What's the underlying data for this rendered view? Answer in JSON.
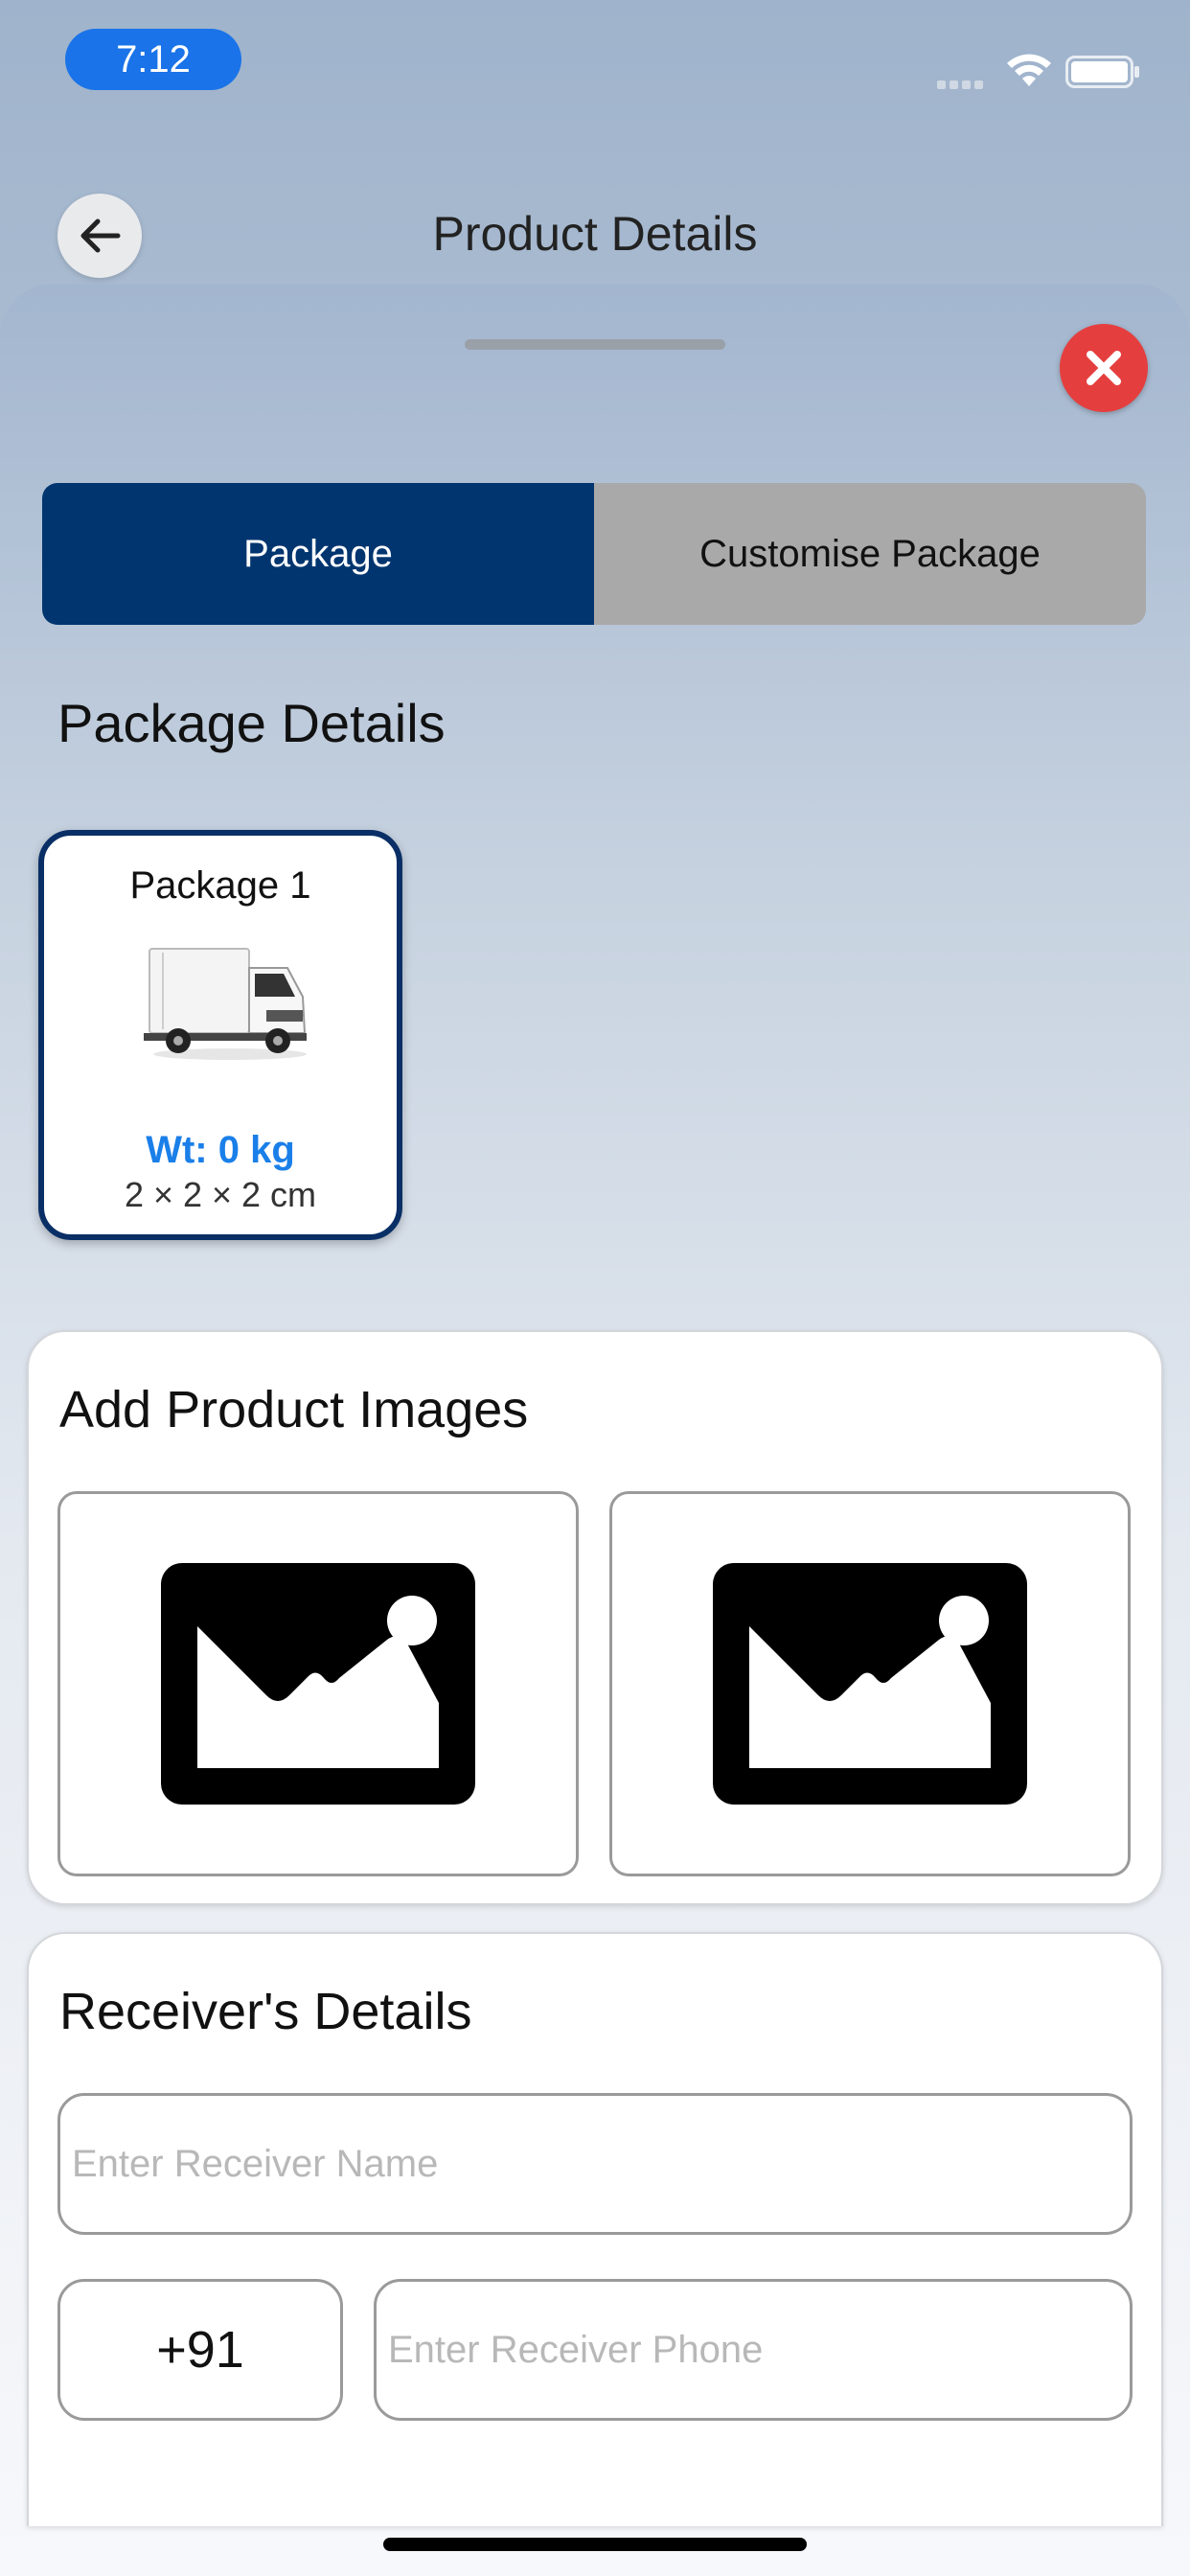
{
  "status_bar": {
    "time": "7:12"
  },
  "header": {
    "title": "Product Details"
  },
  "tabs": [
    {
      "label": "Package",
      "active": true
    },
    {
      "label": "Customise Package",
      "active": false
    }
  ],
  "package_details": {
    "heading": "Package Details",
    "packages": [
      {
        "name": "Package 1",
        "weight": "Wt: 0 kg",
        "dimensions": "2 × 2 × 2 cm",
        "icon": "truck-image"
      }
    ]
  },
  "product_images": {
    "heading": "Add Product Images",
    "slots": [
      {
        "icon": "image-placeholder-icon"
      },
      {
        "icon": "image-placeholder-icon"
      }
    ]
  },
  "receiver": {
    "heading": "Receiver's Details",
    "name_placeholder": "Enter Receiver Name",
    "country_code": "+91",
    "phone_placeholder": "Enter Receiver Phone"
  },
  "colors": {
    "primary": "#00356f",
    "accent_blue": "#1a7fe8",
    "close_red": "#e53e3e",
    "tab_inactive": "#a9a9a9"
  }
}
